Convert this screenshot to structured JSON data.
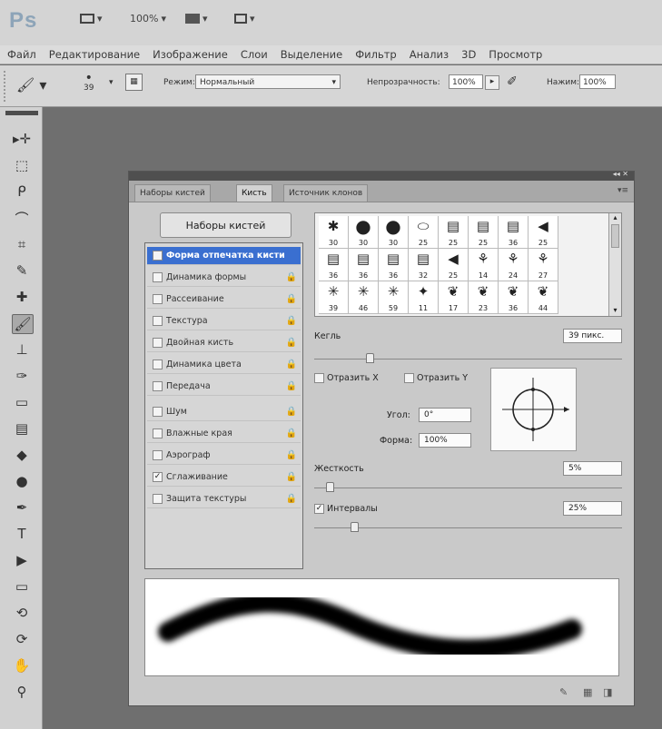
{
  "app": {
    "logo": "Ps",
    "zoom": "100%",
    "mode_icon": "screen-mode-icon",
    "arrange_icon": "arrange-icon"
  },
  "menu": [
    "Файл",
    "Редактирование",
    "Изображение",
    "Слои",
    "Выделение",
    "Фильтр",
    "Анализ",
    "3D",
    "Просмотр"
  ],
  "options": {
    "brush_size": "39",
    "mode_label": "Режим:",
    "mode_value": "Нормальный",
    "opacity_label": "Непрозрачность:",
    "opacity_value": "100%",
    "pressure_label": "Нажим:",
    "pressure_value": "100%"
  },
  "panel": {
    "tabs": [
      "Наборы кистей",
      "Кисть",
      "Источник клонов"
    ],
    "active_tab": "Кисть",
    "presets_button": "Наборы кистей",
    "brush_options": [
      {
        "label": "Форма отпечатка кисти",
        "checked": false,
        "selected": true,
        "lock": false
      },
      {
        "label": "Динамика формы",
        "checked": false,
        "selected": false,
        "lock": true
      },
      {
        "label": "Рассеивание",
        "checked": false,
        "selected": false,
        "lock": true
      },
      {
        "label": "Текстура",
        "checked": false,
        "selected": false,
        "lock": true
      },
      {
        "label": "Двойная кисть",
        "checked": false,
        "selected": false,
        "lock": true
      },
      {
        "label": "Динамика цвета",
        "checked": false,
        "selected": false,
        "lock": true
      },
      {
        "label": "Передача",
        "checked": false,
        "selected": false,
        "lock": true
      },
      {
        "label": "Шум",
        "checked": false,
        "selected": false,
        "lock": true
      },
      {
        "label": "Влажные края",
        "checked": false,
        "selected": false,
        "lock": true
      },
      {
        "label": "Аэрограф",
        "checked": false,
        "selected": false,
        "lock": true
      },
      {
        "label": "Сглаживание",
        "checked": true,
        "selected": false,
        "lock": true
      },
      {
        "label": "Защита текстуры",
        "checked": false,
        "selected": false,
        "lock": true
      }
    ],
    "brush_tips": [
      {
        "size": "30",
        "icon": "soft-round-brush-icon"
      },
      {
        "size": "30",
        "icon": "hard-round-brush-icon"
      },
      {
        "size": "30",
        "icon": "hard-round-brush-icon"
      },
      {
        "size": "25",
        "icon": "flat-brush-icon"
      },
      {
        "size": "25",
        "icon": "chalk-brush-icon"
      },
      {
        "size": "25",
        "icon": "chalk-brush-icon"
      },
      {
        "size": "36",
        "icon": "chalk-brush-icon"
      },
      {
        "size": "25",
        "icon": "spray-brush-icon"
      },
      {
        "size": "36",
        "icon": "chalk-brush-icon"
      },
      {
        "size": "36",
        "icon": "chalk-brush-icon"
      },
      {
        "size": "36",
        "icon": "chalk-brush-icon"
      },
      {
        "size": "32",
        "icon": "chalk-brush-icon"
      },
      {
        "size": "25",
        "icon": "spray-brush-icon"
      },
      {
        "size": "14",
        "icon": "grass-brush-icon"
      },
      {
        "size": "24",
        "icon": "grass-brush-icon"
      },
      {
        "size": "27",
        "icon": "grass-brush-icon"
      },
      {
        "size": "39",
        "icon": "star-brush-icon"
      },
      {
        "size": "46",
        "icon": "star-brush-icon"
      },
      {
        "size": "59",
        "icon": "star-brush-icon"
      },
      {
        "size": "11",
        "icon": "scatter-brush-icon"
      },
      {
        "size": "17",
        "icon": "leaf-brush-icon"
      },
      {
        "size": "23",
        "icon": "leaf-brush-icon"
      },
      {
        "size": "36",
        "icon": "leaf-brush-icon"
      },
      {
        "size": "44",
        "icon": "leaf-brush-icon"
      }
    ],
    "size_label": "Кегль",
    "size_value": "39 пикс.",
    "size_fraction": 0.18,
    "flip_x": "Отразить X",
    "flip_y": "Отразить Y",
    "angle_label": "Угол:",
    "angle_value": "0°",
    "roundness_label": "Форма:",
    "roundness_value": "100%",
    "hardness_label": "Жесткость",
    "hardness_value": "5%",
    "hardness_fraction": 0.05,
    "spacing_label": "Интервалы",
    "spacing_value": "25%",
    "spacing_checked": true,
    "spacing_fraction": 0.13
  },
  "tools": [
    "move-icon",
    "marquee-icon",
    "lasso-icon",
    "quick-select-icon",
    "crop-icon",
    "eyedropper-icon",
    "healing-icon",
    "brush-icon",
    "stamp-icon",
    "history-brush-icon",
    "eraser-icon",
    "gradient-icon",
    "blur-icon",
    "dodge-icon",
    "pen-icon",
    "type-icon",
    "path-select-icon",
    "shape-icon",
    "3d-rotate-icon",
    "3d-orbit-icon",
    "hand-icon",
    "zoom-icon"
  ]
}
